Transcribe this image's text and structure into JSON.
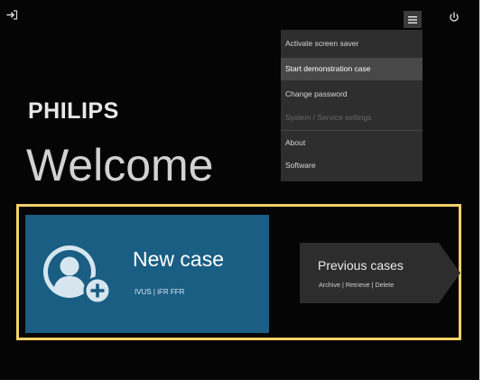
{
  "topbar": {
    "logout_icon": "logout-icon",
    "menu_icon": "hamburger-menu-icon",
    "power_icon": "power-icon"
  },
  "menu": {
    "items": [
      {
        "label": "Activate screen saver",
        "state": "normal"
      },
      {
        "label": "Start demonstration case",
        "state": "highlighted"
      },
      {
        "label": "Change password",
        "state": "normal"
      },
      {
        "label": "System / Service settings",
        "state": "disabled"
      },
      {
        "label": "About",
        "state": "normal"
      },
      {
        "label": "Software",
        "state": "normal"
      }
    ]
  },
  "brand": {
    "logo_text": "PHILIPS"
  },
  "welcome": {
    "title": "Welcome"
  },
  "new_case": {
    "title": "New case",
    "subtitle": "IVUS | iFR FFR",
    "icon": "add-user-icon"
  },
  "previous_cases": {
    "title": "Previous cases",
    "subtitle": "Archive | Retrieve | Delete"
  },
  "colors": {
    "background": "#050505",
    "highlight_border": "#f4d168",
    "new_case_tile": "#1a5e84",
    "previous_case_tile": "#2d2d2d",
    "menu_background": "#2e2e2e"
  }
}
